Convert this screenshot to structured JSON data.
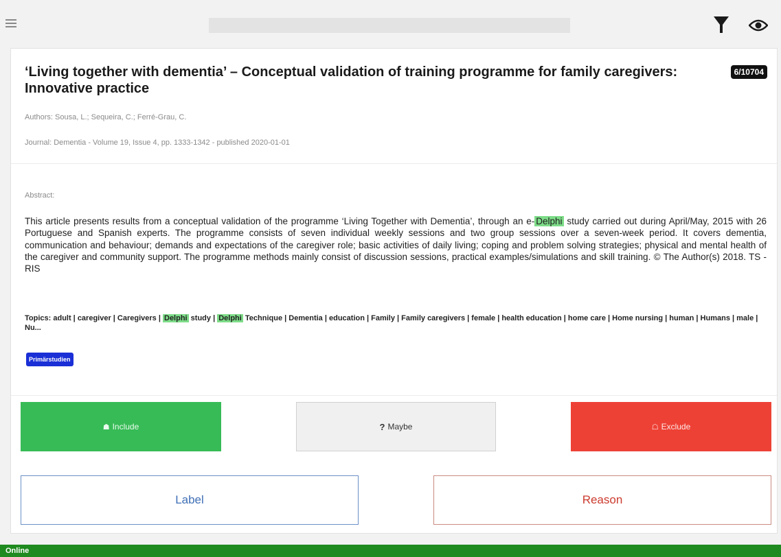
{
  "search": {
    "value": "",
    "placeholder": ""
  },
  "icons": {
    "menu": "hamburger-menu-icon",
    "filter": "funnel-icon",
    "view": "eye-icon"
  },
  "record": {
    "title": "‘Living together with dementia’ – Conceptual validation of training programme for family caregivers: Innovative practice",
    "counter": "6/10704",
    "authors": "Authors: Sousa, L.; Sequeira, C.; Ferré-Grau, C.",
    "journal": "Journal: Dementia - Volume 19, Issue 4, pp. 1333-1342 - published 2020-01-01",
    "abstract_label": "Abstract:",
    "abstract": {
      "before": "This article presents results from a conceptual validation of the programme ‘Living Together with Dementia’, through an e-",
      "highlight": "Delphi",
      "after": " study carried out during April/May, 2015 with 26 Portuguese and Spanish experts. The programme consists of seven individual weekly sessions and two group sessions over a seven-week period. It covers dementia, communication and behaviour; demands and expectations of the caregiver role; basic activities of daily living; coping and problem solving strategies; physical and mental health of the caregiver and community support. The programme methods mainly consist of discussion sessions, practical examples/simulations and skill training. © The Author(s) 2018. TS - RIS"
    },
    "topics": {
      "part1": "Topics: adult | caregiver | Caregivers | ",
      "hl1": "Delphi",
      "part2": " study | ",
      "hl2": "Delphi",
      "part3": " Technique | Dementia | education | Family | Family caregivers | female | health education | home care | Home nursing | human | Humans | male | Nu..."
    },
    "tag": "Primärstudien"
  },
  "actions": {
    "include": "Include",
    "maybe": "Maybe",
    "exclude": "Exclude",
    "label": "Label",
    "reason": "Reason"
  },
  "colors": {
    "include": "#37bb56",
    "exclude": "#ee4136",
    "highlight": "#7ddc88",
    "tag": "#1a2fd6",
    "status": "#1f8a1f"
  },
  "status": "Online"
}
